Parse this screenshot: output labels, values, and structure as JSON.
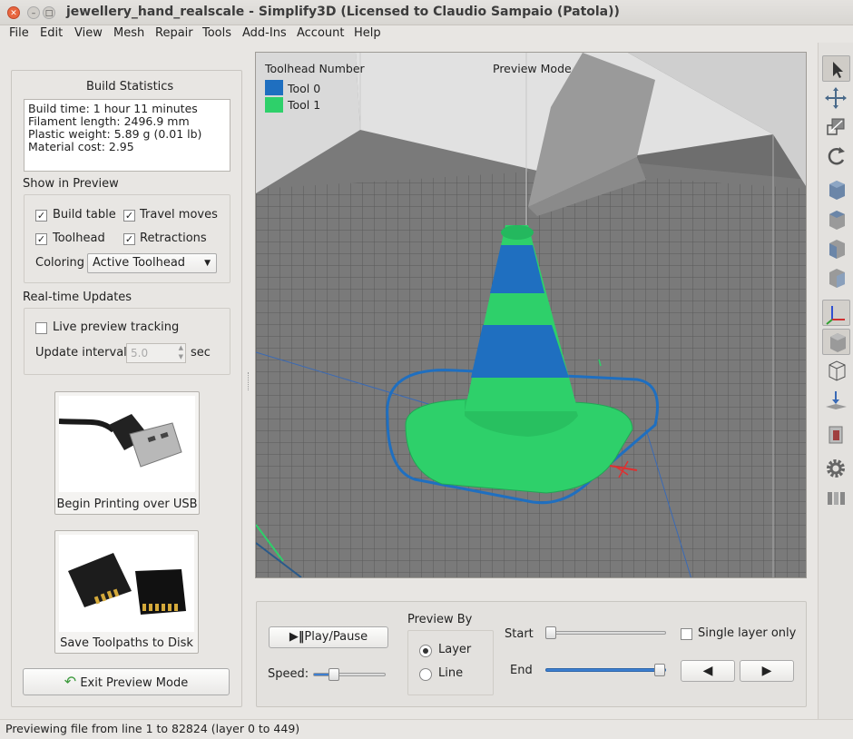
{
  "window": {
    "title": "jewellery_hand_realscale - Simplify3D (Licensed to Claudio Sampaio (Patola))"
  },
  "menu": [
    "File",
    "Edit",
    "View",
    "Mesh",
    "Repair",
    "Tools",
    "Add-Ins",
    "Account",
    "Help"
  ],
  "build_statistics": {
    "title": "Build Statistics",
    "lines": [
      "Build time: 1 hour 11 minutes",
      "Filament length: 2496.9 mm",
      "Plastic weight: 5.89 g (0.01 lb)",
      "Material cost: 2.95"
    ]
  },
  "show_in_preview": {
    "title": "Show in Preview",
    "build_table": {
      "label": "Build table",
      "checked": true
    },
    "travel_moves": {
      "label": "Travel moves",
      "checked": true
    },
    "toolhead": {
      "label": "Toolhead",
      "checked": true
    },
    "retractions": {
      "label": "Retractions",
      "checked": true
    },
    "coloring_label": "Coloring",
    "coloring_value": "Active Toolhead"
  },
  "realtime": {
    "title": "Real-time Updates",
    "live_label": "Live preview tracking",
    "live_checked": false,
    "interval_label": "Update interval",
    "interval_value": "5.0",
    "interval_unit": "sec"
  },
  "usb_button": {
    "label": "Begin Printing over USB"
  },
  "disk_button": {
    "label": "Save Toolpaths to Disk"
  },
  "exit_button": {
    "label": "Exit Preview Mode"
  },
  "viewport": {
    "legend_title": "Toolhead Number",
    "mode_label": "Preview Mode",
    "legend": [
      {
        "name": "Tool 0",
        "color": "#1f6fc0"
      },
      {
        "name": "Tool 1",
        "color": "#2ed06a"
      }
    ]
  },
  "playback": {
    "play_label": "Play/Pause",
    "speed_label": "Speed:",
    "speed_level": 0.25,
    "preview_by_title": "Preview By",
    "layer_label": "Layer",
    "line_label": "Line",
    "selected": "Layer",
    "start_label": "Start",
    "start_level": 0.0,
    "end_label": "End",
    "end_level": 1.0,
    "single_layer_label": "Single layer only",
    "single_layer_checked": false
  },
  "colors": {
    "accent": "#3d7fd1",
    "tool0": "#1f6fc0",
    "tool1": "#2ed06a"
  },
  "status": "Previewing file from line 1 to 82824 (layer 0 to 449)"
}
